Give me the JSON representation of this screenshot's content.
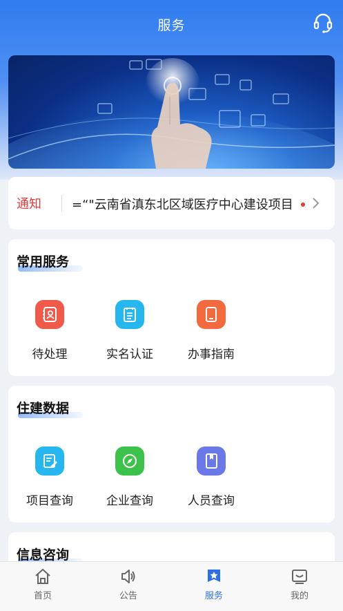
{
  "header": {
    "title": "服务",
    "support_icon": "headset-icon"
  },
  "banner": {
    "alt": ""
  },
  "notice": {
    "tag": "通知",
    "text": "\"云南省滇东北区域医疗中心建设项目",
    "leading_mark": "=“"
  },
  "sections": {
    "common": {
      "title": "常用服务",
      "items": [
        {
          "label": "待处理",
          "icon": "pending-icon",
          "color": "#f05a4a"
        },
        {
          "label": "实名认证",
          "icon": "id-card-icon",
          "color": "#26b7ef"
        },
        {
          "label": "办事指南",
          "icon": "tablet-guide-icon",
          "color": "#f26a3d"
        }
      ]
    },
    "data": {
      "title": "住建数据",
      "items": [
        {
          "label": "项目查询",
          "icon": "project-doc-icon",
          "color": "#26b7ef"
        },
        {
          "label": "企业查询",
          "icon": "compass-icon",
          "color": "#3cc24a"
        },
        {
          "label": "人员查询",
          "icon": "person-book-icon",
          "color": "#6b78e8"
        }
      ]
    },
    "info": {
      "title": "信息咨询"
    }
  },
  "tabbar": {
    "items": [
      {
        "label": "首页",
        "icon": "home-icon"
      },
      {
        "label": "公告",
        "icon": "speaker-icon"
      },
      {
        "label": "服务",
        "icon": "service-star-icon"
      },
      {
        "label": "我的",
        "icon": "profile-icon"
      }
    ],
    "active_index": 2,
    "active_color": "#2e6fe6"
  }
}
